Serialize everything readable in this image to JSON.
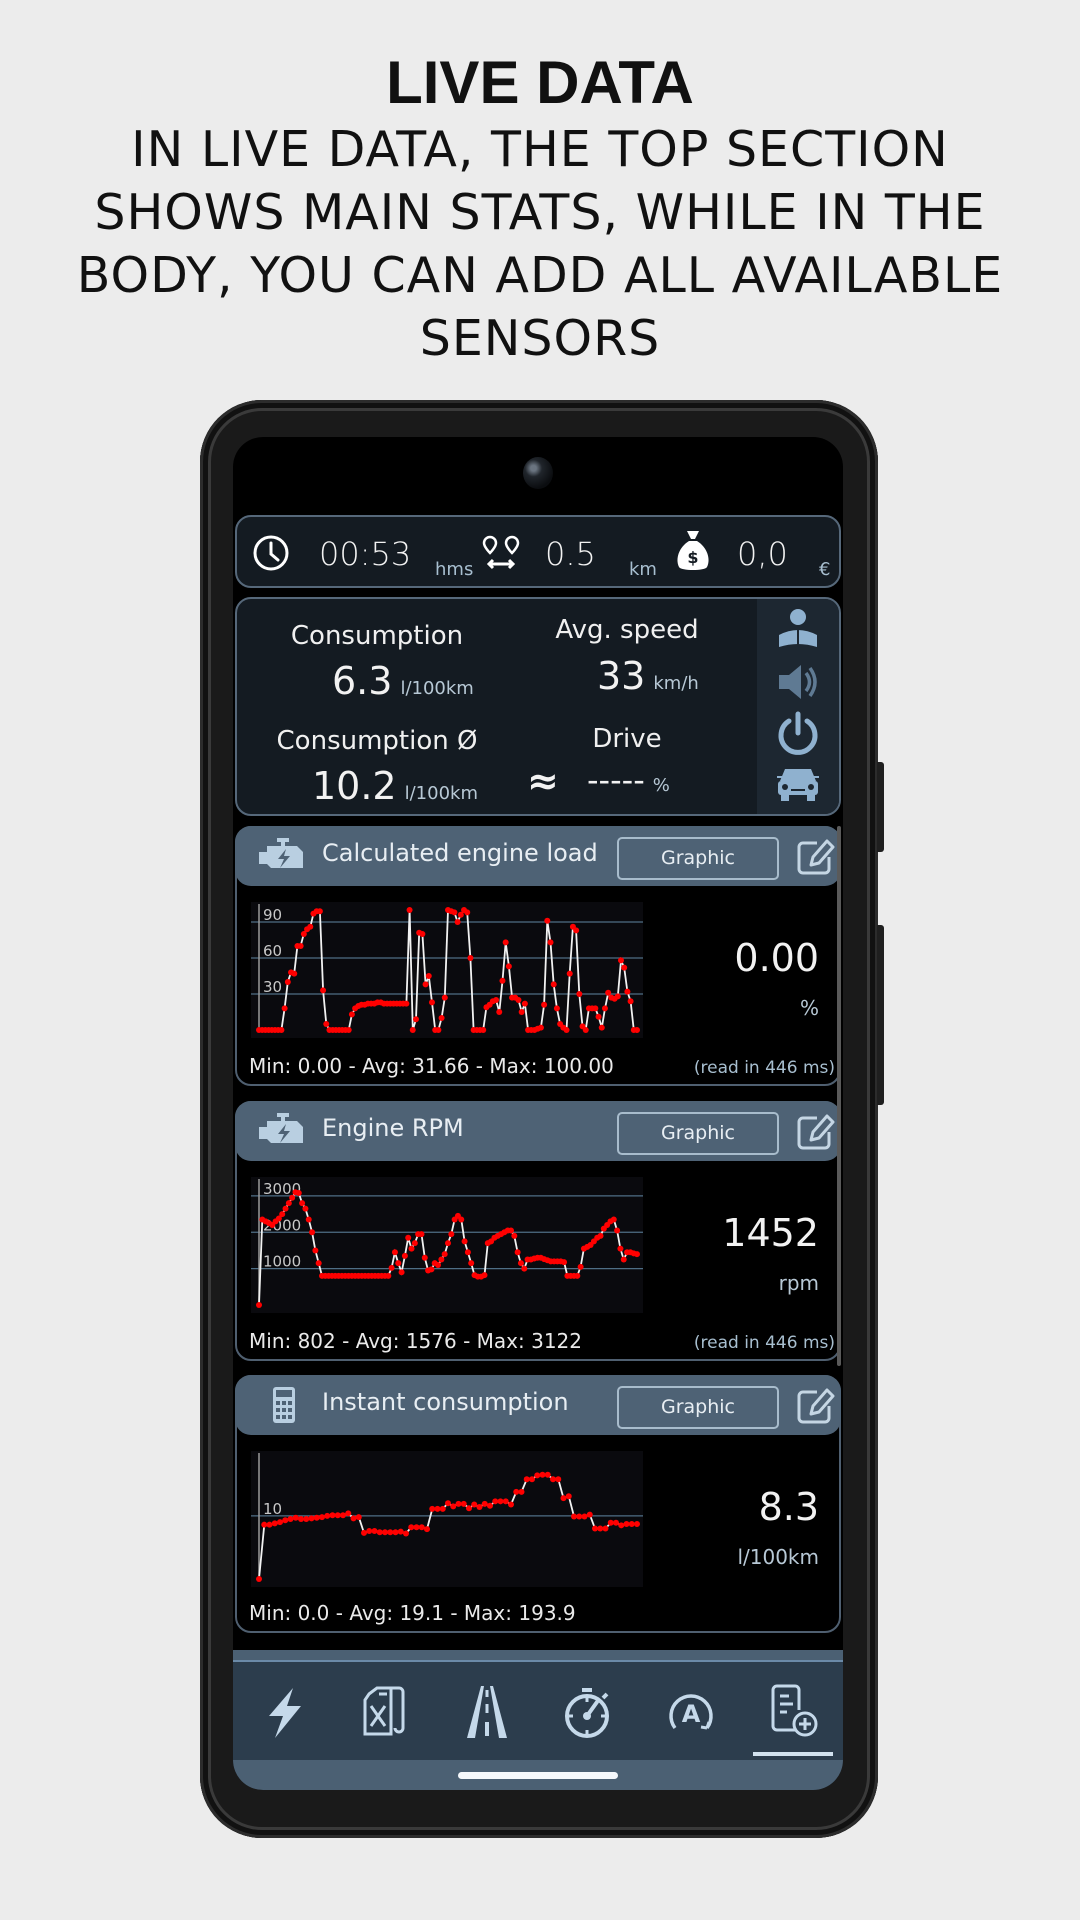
{
  "headline": {
    "title": "LIVE DATA",
    "subtitle": "IN LIVE DATA, THE TOP SECTION SHOWS MAIN STATS, WHILE IN THE BODY, YOU CAN ADD ALL AVAILABLE SENSORS"
  },
  "trip_bar": {
    "time": {
      "icon": "clock-icon",
      "value": "00:53",
      "unit": "hms"
    },
    "distance": {
      "icon": "route-distance-icon",
      "value": "0.5",
      "unit": "km"
    },
    "cost": {
      "icon": "money-bag-icon",
      "value": "0,0",
      "unit": "€"
    }
  },
  "stats": {
    "consumption": {
      "label": "Consumption",
      "value": "6.3",
      "unit": "l/100km"
    },
    "avg_speed": {
      "label": "Avg. speed",
      "value": "33",
      "unit": "km/h"
    },
    "consumption_avg": {
      "label": "Consumption Ø",
      "value": "10.2",
      "unit": "l/100km"
    },
    "drive": {
      "label": "Drive",
      "symbol": "≈",
      "value": "-----",
      "unit": "%"
    },
    "side_icons": [
      "reader-icon",
      "speaker-icon",
      "power-icon",
      "car-icon"
    ]
  },
  "sensors": [
    {
      "title": "Calculated engine load",
      "icon": "engine-icon",
      "mode": "Graphic",
      "value": "0.00",
      "unit": "%",
      "minmax": "Min: 0.00 - Avg: 31.66 - Max: 100.00",
      "read_time": "(read in 446 ms)"
    },
    {
      "title": "Engine RPM",
      "icon": "engine-icon",
      "mode": "Graphic",
      "value": "1452",
      "unit": "rpm",
      "minmax": "Min: 802 - Avg: 1576 - Max: 3122",
      "read_time": "(read in 446 ms)"
    },
    {
      "title": "Instant consumption",
      "icon": "calculator-icon",
      "mode": "Graphic",
      "value": "8.3",
      "unit": "l/100km",
      "minmax": "Min: 0.0 - Avg: 19.1 - Max: 193.9",
      "read_time": ""
    }
  ],
  "bottom_nav": [
    {
      "icon": "lightning-icon",
      "active": false
    },
    {
      "icon": "fuel-can-icon",
      "active": false
    },
    {
      "icon": "road-icon",
      "active": false
    },
    {
      "icon": "stopwatch-icon",
      "active": false
    },
    {
      "icon": "auto-start-stop-icon",
      "active": false
    },
    {
      "icon": "add-report-icon",
      "active": true
    }
  ],
  "colors": {
    "line": "#f2f2f2",
    "points": "#ff0000",
    "grid": "#4f6e85",
    "header": "#4e6275",
    "panel": "#141b22"
  },
  "chart_data": [
    {
      "type": "line",
      "title": "Calculated engine load",
      "ylabel": "%",
      "ylim": [
        0,
        100
      ],
      "yticks": [
        30,
        60,
        90
      ],
      "y": [
        0,
        0,
        0,
        0,
        0,
        0,
        0,
        0,
        18,
        40,
        48,
        47,
        70,
        70,
        80,
        84,
        86,
        97,
        99,
        99,
        33,
        5,
        0,
        0,
        0,
        0,
        0,
        0,
        0,
        13,
        18,
        20,
        21,
        21,
        22,
        22,
        22,
        23,
        23,
        22,
        22,
        22,
        22,
        22,
        22,
        22,
        22,
        100,
        0,
        9,
        81,
        80,
        38,
        45,
        23,
        0,
        0,
        10,
        27,
        100,
        99,
        98,
        90,
        96,
        100,
        98,
        60,
        0,
        0,
        0,
        0,
        19,
        21,
        24,
        25,
        15,
        41,
        73,
        53,
        27,
        27,
        25,
        15,
        22,
        0,
        0,
        0,
        1,
        2,
        21,
        91,
        73,
        38,
        18,
        5,
        2,
        0,
        47,
        86,
        83,
        30,
        3,
        0,
        18,
        18,
        18,
        11,
        2,
        18,
        31,
        27,
        26,
        28,
        58,
        52,
        32,
        24,
        0,
        0
      ]
    },
    {
      "type": "line",
      "title": "Engine RPM",
      "ylabel": "rpm",
      "ylim": [
        0,
        3300
      ],
      "yticks": [
        1000,
        2000,
        3000
      ],
      "y": [
        0,
        2350,
        2300,
        2250,
        2200,
        2300,
        2380,
        2500,
        2650,
        2800,
        2950,
        3100,
        3080,
        2800,
        2650,
        2350,
        2000,
        1500,
        1150,
        800,
        800,
        800,
        800,
        800,
        800,
        800,
        800,
        800,
        800,
        800,
        800,
        800,
        800,
        800,
        800,
        800,
        800,
        800,
        800,
        800,
        1020,
        1450,
        1150,
        900,
        1350,
        1850,
        1550,
        1700,
        1950,
        1950,
        1300,
        950,
        980,
        1150,
        1100,
        1250,
        1400,
        1700,
        1950,
        2350,
        2450,
        2350,
        1750,
        1450,
        1150,
        820,
        780,
        780,
        820,
        1700,
        1750,
        1850,
        1900,
        1950,
        2000,
        2050,
        2050,
        1900,
        1450,
        1150,
        1000,
        1250,
        1250,
        1280,
        1300,
        1300,
        1260,
        1230,
        1200,
        1200,
        1200,
        1200,
        1180,
        800,
        800,
        800,
        800,
        1050,
        1550,
        1600,
        1650,
        1750,
        1850,
        1900,
        2100,
        2200,
        2300,
        2350,
        2050,
        1550,
        1250,
        1450,
        1450,
        1420,
        1400
      ]
    },
    {
      "type": "line",
      "title": "Instant consumption",
      "ylabel": "l/100km",
      "ylim": [
        0,
        19
      ],
      "yticks": [
        10
      ],
      "y": [
        0,
        8.6,
        8.6,
        8.8,
        9.0,
        9.3,
        9.5,
        9.7,
        9.5,
        9.5,
        9.6,
        9.7,
        9.8,
        10.0,
        10.1,
        10.1,
        10.1,
        10.4,
        9.6,
        9.8,
        7.3,
        7.6,
        7.6,
        7.4,
        7.4,
        7.4,
        7.4,
        7.5,
        7.2,
        8.2,
        8.2,
        8.2,
        7.9,
        11.1,
        11.1,
        11.1,
        12.0,
        11.5,
        11.9,
        11.9,
        11.2,
        11.8,
        11.4,
        11.9,
        11.6,
        12.3,
        12.3,
        12.3,
        11.8,
        13.8,
        13.8,
        15.8,
        15.8,
        16.4,
        16.5,
        16.5,
        15.8,
        15.8,
        12.8,
        13.1,
        9.9,
        9.9,
        9.9,
        10.2,
        8.0,
        8.0,
        8.0,
        8.9,
        8.9,
        8.5,
        8.7,
        8.7,
        8.7
      ]
    }
  ]
}
